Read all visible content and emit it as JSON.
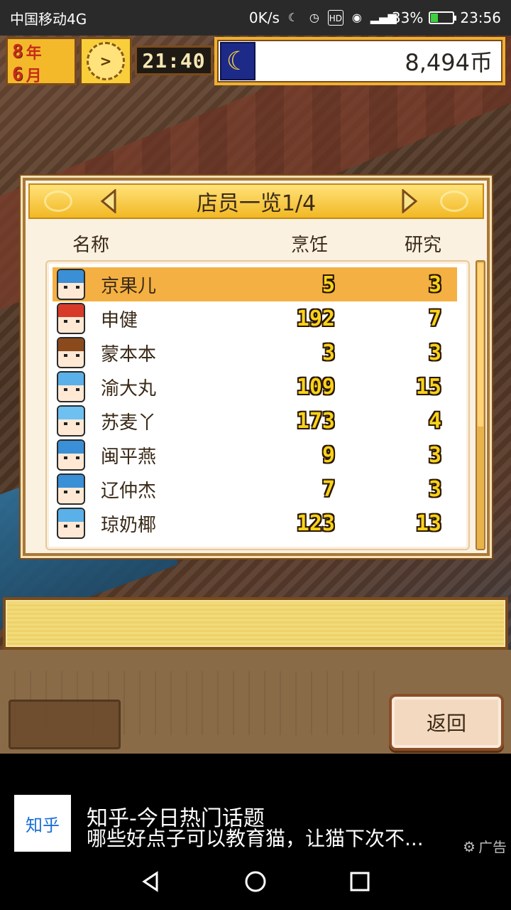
{
  "status_bar": {
    "carrier": "中国移动4G",
    "net_speed": "0K/s",
    "battery_pct": "33%",
    "time": "23:56",
    "battery_level": 0.33
  },
  "hud": {
    "month_num": "8",
    "month_unit": "年",
    "day_num": "6",
    "day_unit": "月",
    "clock_glyph": ">",
    "time": "21:40",
    "money": "8,494币",
    "moon_icon": "moon-icon"
  },
  "dialog": {
    "title": "店员一览1/4",
    "columns": {
      "name": "名称",
      "cooking": "烹饪",
      "research": "研究"
    },
    "staff": [
      {
        "name": "京果儿",
        "cooking": "5",
        "research": "3",
        "selected": true,
        "hair": "#3a8fd6"
      },
      {
        "name": "申健",
        "cooking": "192",
        "research": "7",
        "selected": false,
        "hair": "#d83a2a"
      },
      {
        "name": "蒙本本",
        "cooking": "3",
        "research": "3",
        "selected": false,
        "hair": "#8a4a1c"
      },
      {
        "name": "渝大丸",
        "cooking": "109",
        "research": "15",
        "selected": false,
        "hair": "#5ab0e8"
      },
      {
        "name": "苏麦丫",
        "cooking": "173",
        "research": "4",
        "selected": false,
        "hair": "#6ec0f0"
      },
      {
        "name": "闽平燕",
        "cooking": "9",
        "research": "3",
        "selected": false,
        "hair": "#3a8fd6"
      },
      {
        "name": "辽仲杰",
        "cooking": "7",
        "research": "3",
        "selected": false,
        "hair": "#3a8fd6"
      },
      {
        "name": "琼奶椰",
        "cooking": "123",
        "research": "13",
        "selected": false,
        "hair": "#5ab0e8"
      }
    ]
  },
  "menu": {
    "back_label": "返回"
  },
  "ad": {
    "logo": "知乎",
    "title": "知乎-今日热门话题",
    "subtitle": "哪些好点子可以教育猫，让猫下次不...",
    "tag": "广告"
  }
}
